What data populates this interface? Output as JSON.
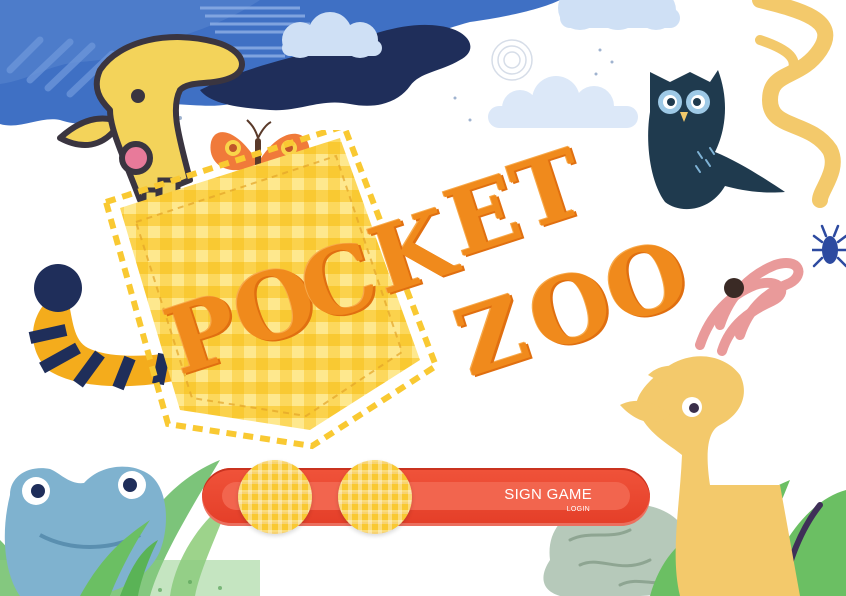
{
  "game": {
    "title_line1": [
      "P",
      "O",
      "C",
      "K",
      "E",
      "T"
    ],
    "title_line2": [
      "Z",
      "O",
      "O"
    ]
  },
  "menu": {
    "sign_game_label": "SIGN GAME",
    "login_label": "LOGIN"
  },
  "colors": {
    "title_orange": "#f08a1c",
    "button_red": "#e8472f",
    "pocket_yellow": "#f9c932",
    "sky_blue": "#3f70c4",
    "navy": "#1f2e5a",
    "cloud_blue": "#cfe0f5"
  },
  "icons": {
    "creature": "yellow-creature",
    "owl": "owl",
    "butterfly": "butterfly",
    "tail": "striped-tail",
    "frog": "frog",
    "gazelle": "gazelle",
    "beetle": "beetle",
    "snake": "snake"
  }
}
